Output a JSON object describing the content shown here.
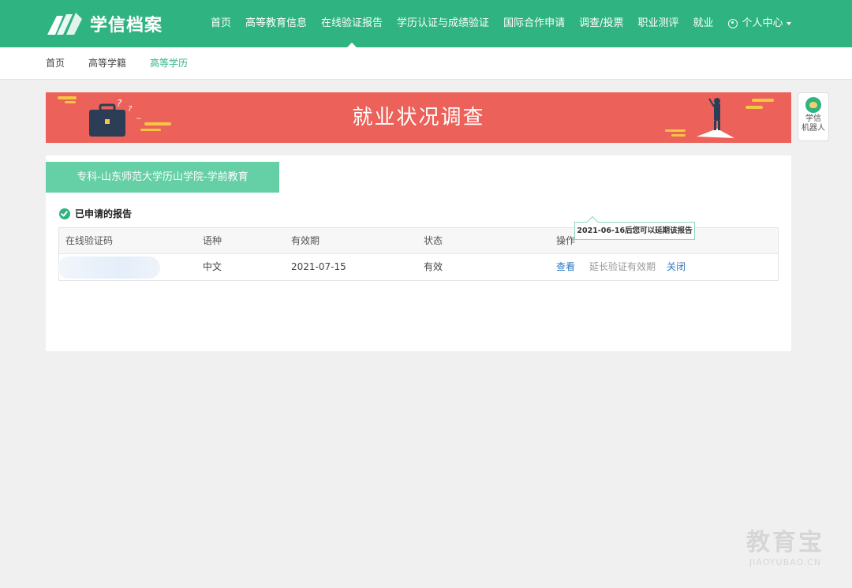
{
  "header": {
    "logo_text": "学信档案",
    "nav": [
      {
        "label": "首页"
      },
      {
        "label": "高等教育信息"
      },
      {
        "label": "在线验证报告"
      },
      {
        "label": "学历认证与成绩验证"
      },
      {
        "label": "国际合作申请"
      },
      {
        "label": "调查/投票"
      },
      {
        "label": "职业测评"
      },
      {
        "label": "就业"
      }
    ],
    "active_nav": "在线验证报告",
    "user_label": "个人中心"
  },
  "subnav": {
    "items": [
      {
        "label": "首页"
      },
      {
        "label": "高等学籍"
      },
      {
        "label": "高等学历"
      }
    ],
    "active": "高等学历"
  },
  "banner": {
    "title": "就业状况调查"
  },
  "robot": {
    "line1": "学信",
    "line2": "机器人"
  },
  "record": {
    "school_tag": "专科-山东师范大学历山学院-学前教育",
    "section_title": "已申请的报告",
    "table": {
      "headers": [
        "在线验证码",
        "语种",
        "有效期",
        "状态",
        "操作"
      ],
      "rows": [
        {
          "code": "",
          "language": "中文",
          "expiry": "2021-07-15",
          "status": "有效",
          "actions": {
            "view": "查看",
            "extend": "延长验证有效期",
            "close": "关闭"
          }
        }
      ]
    },
    "tooltip": "2021-06-16后您可以延期该报告"
  },
  "watermark": {
    "big": "教育宝",
    "small": "JIAOYUBAO.CN"
  },
  "colors": {
    "brand": "#2fb380",
    "banner": "#ec6159",
    "link": "#2f78c4"
  }
}
